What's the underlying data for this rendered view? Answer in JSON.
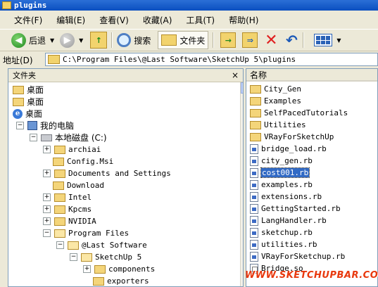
{
  "window": {
    "title": "plugins"
  },
  "menu": [
    "文件(F)",
    "编辑(E)",
    "查看(V)",
    "收藏(A)",
    "工具(T)",
    "帮助(H)"
  ],
  "toolbar": {
    "back_label": "后退",
    "search_label": "搜索",
    "folders_label": "文件夹"
  },
  "address": {
    "label": "地址(D)",
    "value": "C:\\Program Files\\@Last Software\\SketchUp 5\\plugins"
  },
  "left_pane": {
    "title": "文件夹",
    "close_glyph": "×",
    "tree": [
      {
        "label": "桌面",
        "icon": "folder",
        "indent": 0,
        "expander": ""
      },
      {
        "label": "桌面",
        "icon": "folder",
        "indent": 0,
        "expander": ""
      },
      {
        "label": "桌面",
        "icon": "ie",
        "indent": 0,
        "expander": ""
      },
      {
        "label": "我的电脑",
        "icon": "computer",
        "indent": 1,
        "expander": "−"
      },
      {
        "label": "本地磁盘 (C:)",
        "icon": "drive",
        "indent": 2,
        "expander": "−"
      },
      {
        "label": "archiai",
        "icon": "folder",
        "indent": 3,
        "expander": "+"
      },
      {
        "label": "Config.Msi",
        "icon": "folder",
        "indent": 3,
        "expander": ""
      },
      {
        "label": "Documents and Settings",
        "icon": "folder",
        "indent": 3,
        "expander": "+"
      },
      {
        "label": "Download",
        "icon": "folder",
        "indent": 3,
        "expander": ""
      },
      {
        "label": "Intel",
        "icon": "folder",
        "indent": 3,
        "expander": "+"
      },
      {
        "label": "Kpcms",
        "icon": "folder",
        "indent": 3,
        "expander": "+"
      },
      {
        "label": "NVIDIA",
        "icon": "folder",
        "indent": 3,
        "expander": "+"
      },
      {
        "label": "Program Files",
        "icon": "folder-open",
        "indent": 3,
        "expander": "−"
      },
      {
        "label": "@Last Software",
        "icon": "folder-open",
        "indent": 4,
        "expander": "−"
      },
      {
        "label": "SketchUp 5",
        "icon": "folder-open",
        "indent": 5,
        "expander": "−"
      },
      {
        "label": "components",
        "icon": "folder",
        "indent": 6,
        "expander": "+"
      },
      {
        "label": "exporters",
        "icon": "folder",
        "indent": 6,
        "expander": ""
      }
    ]
  },
  "right_pane": {
    "column": "名称",
    "files": [
      {
        "name": "City_Gen",
        "type": "folder"
      },
      {
        "name": "Examples",
        "type": "folder"
      },
      {
        "name": "SelfPacedTutorials",
        "type": "folder"
      },
      {
        "name": "Utilities",
        "type": "folder"
      },
      {
        "name": "VRayForSketchUp",
        "type": "folder"
      },
      {
        "name": "bridge_load.rb",
        "type": "rb"
      },
      {
        "name": "city_gen.rb",
        "type": "rb"
      },
      {
        "name": "cost001.rb",
        "type": "rb",
        "selected": true
      },
      {
        "name": "examples.rb",
        "type": "rb"
      },
      {
        "name": "extensions.rb",
        "type": "rb"
      },
      {
        "name": "GettingStarted.rb",
        "type": "rb"
      },
      {
        "name": "LangHandler.rb",
        "type": "rb"
      },
      {
        "name": "sketchup.rb",
        "type": "rb"
      },
      {
        "name": "utilities.rb",
        "type": "rb"
      },
      {
        "name": "VRayForSketchup.rb",
        "type": "rb"
      },
      {
        "name": "Bridge.so",
        "type": "so"
      }
    ]
  },
  "watermark": "WWW.SKETCHUPBAR.COM"
}
